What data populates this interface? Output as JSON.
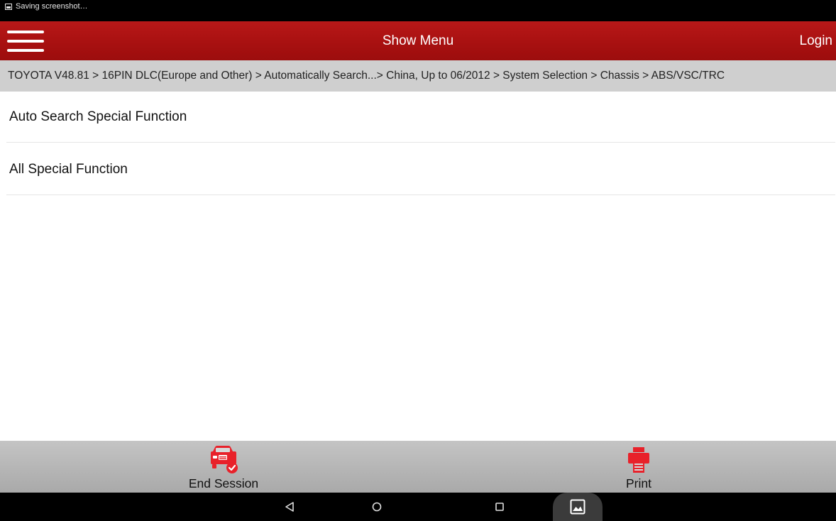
{
  "status_bar": {
    "notification_text": "Saving screenshot…",
    "notification_icon": "image-icon"
  },
  "header": {
    "title": "Show Menu",
    "login_label": "Login",
    "menu_icon": "hamburger-icon",
    "color": "#a71010"
  },
  "breadcrumb": {
    "path": "TOYOTA V48.81 > 16PIN DLC(Europe and Other) > Automatically Search...> China, Up to 06/2012 > System Selection > Chassis > ABS/VSC/TRC"
  },
  "list": {
    "items": [
      {
        "label": "Auto Search Special Function"
      },
      {
        "label": "All Special Function"
      }
    ]
  },
  "toolbar": {
    "end_session_label": "End Session",
    "end_session_icon": "car-check-icon",
    "print_label": "Print",
    "print_icon": "printer-icon",
    "icon_color": "#e8212a"
  },
  "nav_bar": {
    "back_icon": "back-triangle-icon",
    "home_icon": "home-circle-icon",
    "recents_icon": "recents-square-icon",
    "screenshot_icon": "gallery-icon"
  }
}
